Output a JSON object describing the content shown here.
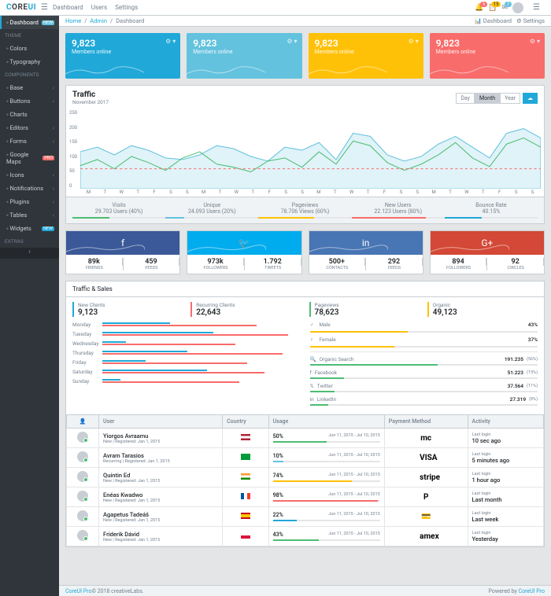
{
  "brand": {
    "c": "C",
    "ore": "ORE",
    "ui": "UI"
  },
  "header": {
    "nav": [
      "Dashboard",
      "Users",
      "Settings"
    ],
    "badges": [
      "5",
      "15",
      "7"
    ]
  },
  "sidebar": {
    "items": [
      {
        "type": "item",
        "label": "Dashboard",
        "badge": "NEW",
        "badgeClass": "bg-info",
        "active": true
      },
      {
        "type": "title",
        "label": "THEME"
      },
      {
        "type": "item",
        "label": "Colors",
        "caret": false
      },
      {
        "type": "item",
        "label": "Typography",
        "caret": false
      },
      {
        "type": "title",
        "label": "COMPONENTS"
      },
      {
        "type": "item",
        "label": "Base",
        "caret": true
      },
      {
        "type": "item",
        "label": "Buttons",
        "caret": true
      },
      {
        "type": "item",
        "label": "Charts",
        "caret": false
      },
      {
        "type": "item",
        "label": "Editors",
        "caret": true
      },
      {
        "type": "item",
        "label": "Forms",
        "caret": true
      },
      {
        "type": "item",
        "label": "Google Maps",
        "badge": "PRO",
        "badgeClass": "bg-danger"
      },
      {
        "type": "item",
        "label": "Icons",
        "caret": true
      },
      {
        "type": "item",
        "label": "Notifications",
        "caret": true
      },
      {
        "type": "item",
        "label": "Plugins",
        "caret": true
      },
      {
        "type": "item",
        "label": "Tables",
        "caret": true
      },
      {
        "type": "item",
        "label": "Widgets",
        "badge": "NEW",
        "badgeClass": "bg-primary"
      },
      {
        "type": "title",
        "label": "EXTRAS"
      }
    ]
  },
  "breadcrumb": {
    "home": "Home",
    "admin": "Admin",
    "current": "Dashboard",
    "right": [
      "Dashboard",
      "Settings"
    ]
  },
  "widgets": [
    {
      "value": "9,823",
      "label": "Members online",
      "class": "w-cyan"
    },
    {
      "value": "9,823",
      "label": "Members online",
      "class": "w-blue"
    },
    {
      "value": "9,823",
      "label": "Members online",
      "class": "w-yellow"
    },
    {
      "value": "9,823",
      "label": "Members online",
      "class": "w-red"
    }
  ],
  "chart_data": {
    "type": "line",
    "title": "Traffic",
    "subtitle": "November 2017",
    "ylim": [
      0,
      250
    ],
    "yticks": [
      "250",
      "200",
      "150",
      "100",
      "50",
      "0"
    ],
    "xticks": [
      "M",
      "T",
      "W",
      "T",
      "F",
      "S",
      "S",
      "M",
      "T",
      "W",
      "T",
      "F",
      "S",
      "S",
      "M",
      "T",
      "W",
      "T",
      "F",
      "S",
      "S",
      "M",
      "T",
      "W",
      "T",
      "F",
      "S",
      "S"
    ],
    "btn_day": "Day",
    "btn_month": "Month",
    "btn_year": "Year",
    "series": [
      {
        "name": "area",
        "color": "#63c2de",
        "values": [
          120,
          135,
          110,
          140,
          125,
          100,
          95,
          110,
          140,
          130,
          105,
          90,
          135,
          125,
          150,
          95,
          180,
          170,
          110,
          90,
          105,
          145,
          170,
          135,
          100,
          180,
          195,
          165
        ]
      },
      {
        "name": "line",
        "color": "#4dbd74",
        "values": [
          75,
          95,
          65,
          105,
          85,
          60,
          100,
          120,
          80,
          70,
          55,
          90,
          100,
          70,
          120,
          80,
          155,
          140,
          85,
          60,
          80,
          110,
          150,
          100,
          72,
          145,
          165,
          135
        ]
      },
      {
        "name": "dashed",
        "color": "#f86c6b",
        "values": [
          65,
          65,
          65,
          65,
          65,
          65,
          65,
          65,
          65,
          65,
          65,
          65,
          65,
          65,
          65,
          65,
          65,
          65,
          65,
          65,
          65,
          65,
          65,
          65,
          65,
          65,
          65,
          65
        ]
      }
    ],
    "footer": [
      {
        "label": "Visits",
        "value": "29.703 Users (40%)",
        "pct": 40,
        "color": "#4dbd74"
      },
      {
        "label": "Unique",
        "value": "24.093 Users (20%)",
        "pct": 20,
        "color": "#63c2de"
      },
      {
        "label": "Pageviews",
        "value": "78.706 Views (60%)",
        "pct": 60,
        "color": "#ffc107"
      },
      {
        "label": "New Users",
        "value": "22.123 Users (80%)",
        "pct": 80,
        "color": "#f86c6b"
      },
      {
        "label": "Bounce Rate",
        "value": "40.15%",
        "pct": 40,
        "color": "#20a8d8"
      }
    ]
  },
  "social": [
    {
      "class": "s-fb",
      "icon": "f",
      "n1": "89k",
      "t1": "FRIENDS",
      "n2": "459",
      "t2": "FEEDS"
    },
    {
      "class": "s-tw",
      "icon": "🐦",
      "n1": "973k",
      "t1": "FOLLOWERS",
      "n2": "1.792",
      "t2": "TWEETS"
    },
    {
      "class": "s-li",
      "icon": "in",
      "n1": "500+",
      "t1": "CONTACTS",
      "n2": "292",
      "t2": "FEEDS"
    },
    {
      "class": "s-gp",
      "icon": "G+",
      "n1": "894",
      "t1": "FOLLOWERS",
      "n2": "92",
      "t2": "CIRCLES"
    }
  ],
  "ts": {
    "title": "Traffic & Sales",
    "metrics": [
      {
        "label": "New Clients",
        "value": "9,123",
        "class": "bl-cyan"
      },
      {
        "label": "Recurring Clients",
        "value": "22,643",
        "class": "bl-red"
      },
      {
        "label": "Pageviews",
        "value": "78,623",
        "class": "bl-green"
      },
      {
        "label": "Organic",
        "value": "49,123",
        "class": "bl-yellow"
      }
    ],
    "days": [
      {
        "day": "Monday",
        "a": 34,
        "b": 78
      },
      {
        "day": "Tuesday",
        "a": 56,
        "b": 94
      },
      {
        "day": "Wednesday",
        "a": 12,
        "b": 67
      },
      {
        "day": "Thursday",
        "a": 43,
        "b": 91
      },
      {
        "day": "Friday",
        "a": 22,
        "b": 73
      },
      {
        "day": "Saturday",
        "a": 53,
        "b": 82
      },
      {
        "day": "Sunday",
        "a": 9,
        "b": 69
      }
    ],
    "gender": [
      {
        "icon": "♂",
        "label": "Male",
        "pct": 43
      },
      {
        "icon": "♀",
        "label": "Female",
        "pct": 37
      }
    ],
    "sources": [
      {
        "icon": "🔍",
        "label": "Organic Search",
        "value": "191.235",
        "unit": "(56%)"
      },
      {
        "icon": "f",
        "label": "Facebook",
        "value": "51.223",
        "unit": "(15%)"
      },
      {
        "icon": "𝕏",
        "label": "Twitter",
        "value": "37.564",
        "unit": "(11%)"
      },
      {
        "icon": "in",
        "label": "LinkedIn",
        "value": "27.319",
        "unit": "(8%)"
      }
    ]
  },
  "users": {
    "headers": [
      "",
      "User",
      "Country",
      "Usage",
      "Payment Method",
      "Activity"
    ],
    "rows": [
      {
        "name": "Yiorgos Avraamu",
        "sub": "New | Registered: Jan 1, 2015",
        "flag": "fl-us",
        "pct": 50,
        "color": "#4dbd74",
        "dates": "Jun 11, 2015 - Jul 10, 2015",
        "pay": "mc",
        "act_label": "Last login",
        "act": "10 sec ago"
      },
      {
        "name": "Avram Tarasios",
        "sub": "Recurring | Registered: Jan 1, 2015",
        "flag": "fl-br",
        "pct": 10,
        "color": "#63c2de",
        "dates": "Jun 11, 2015 - Jul 10, 2015",
        "pay": "VISA",
        "act_label": "Last login",
        "act": "5 minutes ago"
      },
      {
        "name": "Quintin Ed",
        "sub": "New | Registered: Jan 1, 2015",
        "flag": "fl-in",
        "pct": 74,
        "color": "#ffc107",
        "dates": "Jun 11, 2015 - Jul 10, 2015",
        "pay": "stripe",
        "act_label": "Last login",
        "act": "1 hour ago"
      },
      {
        "name": "Enéas Kwadwo",
        "sub": "New | Registered: Jan 1, 2015",
        "flag": "fl-fr",
        "pct": 98,
        "color": "#f86c6b",
        "dates": "Jun 11, 2015 - Jul 10, 2015",
        "pay": "P",
        "act_label": "Last login",
        "act": "Last month"
      },
      {
        "name": "Agapetus Tadeáš",
        "sub": "New | Registered: Jan 1, 2015",
        "flag": "fl-es",
        "pct": 22,
        "color": "#20a8d8",
        "dates": "Jun 11, 2015 - Jul 10, 2015",
        "pay": "💳",
        "act_label": "Last login",
        "act": "Last week"
      },
      {
        "name": "Friderik Dávid",
        "sub": "New | Registered: Jan 1, 2015",
        "flag": "fl-pl",
        "pct": 43,
        "color": "#4dbd74",
        "dates": "Jun 11, 2015 - Jul 10, 2015",
        "pay": "amex",
        "act_label": "Last login",
        "act": "Yesterday"
      }
    ]
  },
  "footer": {
    "brand": "CoreUI Pro",
    "copy": " © 2018 creativeLabs.",
    "powered": "Powered by ",
    "link": "CoreUI Pro"
  }
}
